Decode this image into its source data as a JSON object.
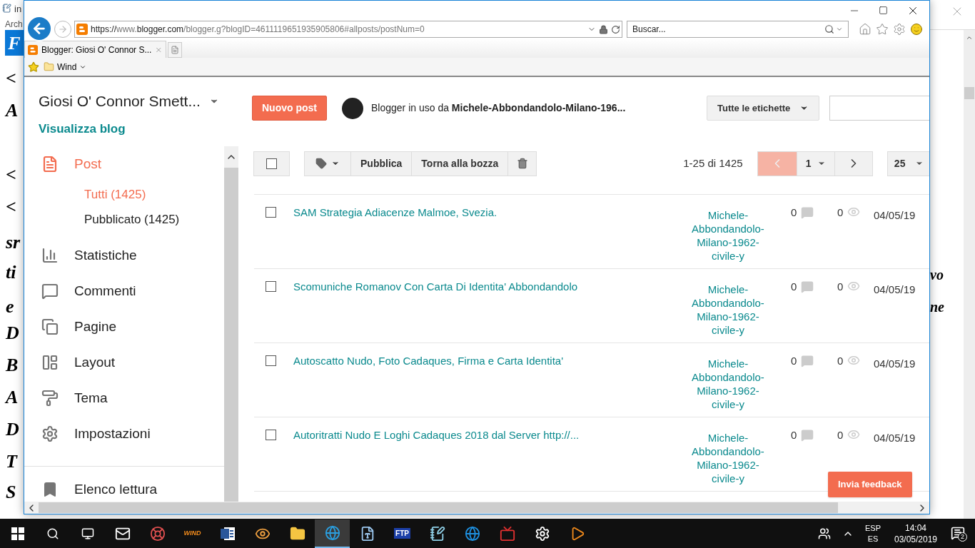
{
  "background_window": {
    "title": "in",
    "menu": "Arch",
    "badge": "F",
    "left_fragments": [
      "<",
      "A",
      "<",
      "<",
      "sr",
      "ti",
      "e",
      "D",
      "B",
      "A",
      "D",
      "T",
      "S"
    ],
    "right_fragments": [
      "vo",
      "ne"
    ]
  },
  "browser": {
    "address": {
      "prefix": "https://www.",
      "domain": "blogger.com",
      "path": "/blogger.g?blogID=4611119651935905806#allposts/postNum=0"
    },
    "search": {
      "placeholder": "Buscar..."
    },
    "tabs": [
      {
        "label": "Blogger: Giosi O' Connor S...",
        "selected": true
      }
    ],
    "favorites": [
      {
        "label": "Wind"
      }
    ]
  },
  "blogger": {
    "blog_title": "Giosi O' Connor Smett...",
    "view_blog": "Visualizza blog",
    "new_post": "Nuovo post",
    "user_line": "Blogger in uso da **Michele-Abbondandolo-Milano-196...**",
    "labels_filter": "Tutte le etichette",
    "nav": [
      {
        "label": "Post",
        "selected": true,
        "children": [
          {
            "label": "Tutti (1425)",
            "selected": true
          },
          {
            "label": "Pubblicato (1425)",
            "selected": false
          }
        ]
      },
      {
        "label": "Statistiche",
        "selected": false
      },
      {
        "label": "Commenti",
        "selected": false
      },
      {
        "label": "Pagine",
        "selected": false
      },
      {
        "label": "Layout",
        "selected": false
      },
      {
        "label": "Tema",
        "selected": false
      },
      {
        "label": "Impostazioni",
        "selected": false
      }
    ],
    "footer_nav": [
      {
        "label": "Elenco lettura",
        "selected": false
      }
    ],
    "toolbar": {
      "publish": "Pubblica",
      "revert": "Torna alla bozza",
      "range": "1-25 di 1425",
      "page": "1",
      "per_page": "25",
      "prev_disabled": true
    },
    "posts": [
      {
        "title": "SAM Strategia Adiacenze Malmoe, Svezia.",
        "author": [
          "Michele-",
          "Abbondandolo-",
          "Milano-1962-",
          "civile-y"
        ],
        "comments": "0",
        "views": "0",
        "date": "04/05/19",
        "checked": false
      },
      {
        "title": "Scomuniche Romanov Con Carta Di Identita' Abbondandolo",
        "author": [
          "Michele-",
          "Abbondandolo-",
          "Milano-1962-",
          "civile-y"
        ],
        "comments": "0",
        "views": "0",
        "date": "04/05/19",
        "checked": false
      },
      {
        "title": "Autoscatto Nudo, Foto Cadaques, Firma e Carta Identita'",
        "author": [
          "Michele-",
          "Abbondandolo-",
          "Milano-1962-",
          "civile-y"
        ],
        "comments": "0",
        "views": "0",
        "date": "04/05/19",
        "checked": false
      },
      {
        "title": "Autoritratti Nudo E Loghi Cadaques 2018 dal Server http://...",
        "author": [
          "Michele-",
          "Abbondandolo-",
          "Milano-1962-",
          "civile-y"
        ],
        "comments": "0",
        "views": "0",
        "date": "04/05/19",
        "checked": false
      }
    ],
    "feedback": "Invia feedback"
  },
  "taskbar": {
    "items": [
      {
        "kind": "start"
      },
      {
        "kind": "search"
      },
      {
        "kind": "taskview"
      },
      {
        "kind": "mail"
      },
      {
        "kind": "lifebuoy"
      },
      {
        "kind": "wind",
        "label": "WIND"
      },
      {
        "kind": "word"
      },
      {
        "kind": "eye"
      },
      {
        "kind": "folder"
      },
      {
        "kind": "ie",
        "selected": true
      },
      {
        "kind": "reader"
      },
      {
        "kind": "ftp",
        "label": "FTP"
      },
      {
        "kind": "notepad"
      },
      {
        "kind": "edge"
      },
      {
        "kind": "tv"
      },
      {
        "kind": "gear"
      },
      {
        "kind": "player"
      }
    ],
    "language": [
      "ESP",
      "ES"
    ],
    "time": "14:04",
    "date": "03/05/2019",
    "notifications": "2"
  }
}
